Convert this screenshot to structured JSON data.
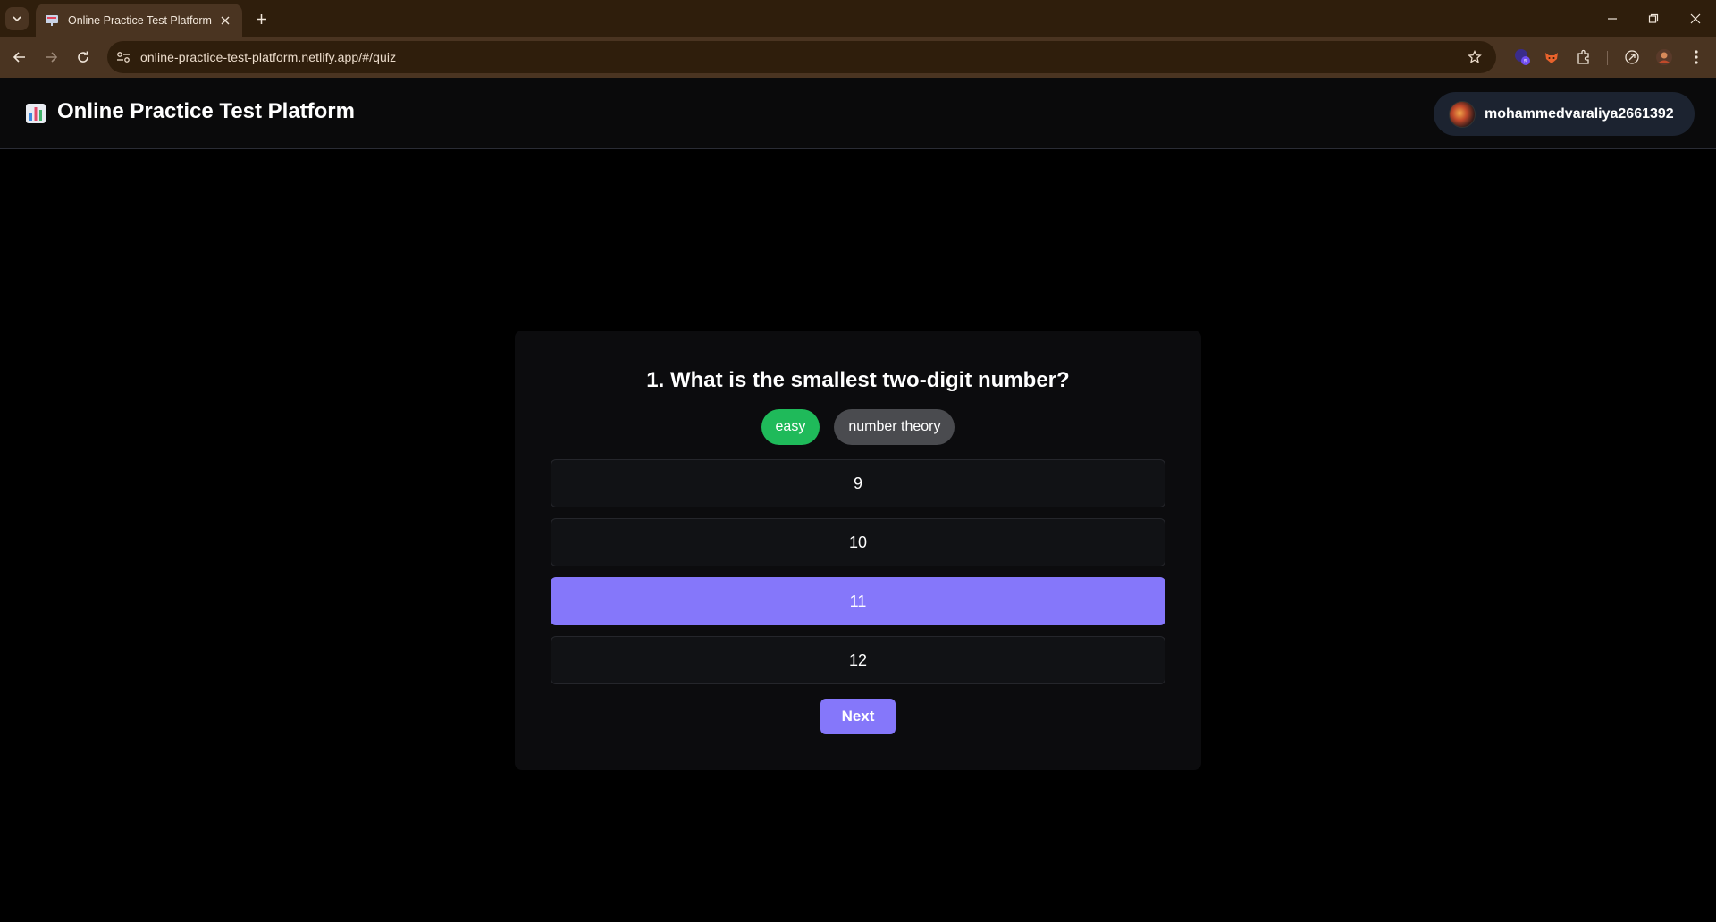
{
  "browser": {
    "tab_title": "Online Practice Test Platform",
    "url": "online-practice-test-platform.netlify.app/#/quiz",
    "extension_badge": "5"
  },
  "app": {
    "title": "Online Practice Test Platform",
    "username": "mohammedvaraliya2661392"
  },
  "quiz": {
    "question": "1. What is the smallest two-digit number?",
    "tags": [
      "easy",
      "number theory"
    ],
    "options": [
      "9",
      "10",
      "11",
      "12"
    ],
    "selected_option": "11",
    "next_label": "Next"
  },
  "colors": {
    "accent": "#8577fa",
    "easy_tag": "#1fba5a",
    "topic_tag": "#4a4b4f",
    "background": "#000000",
    "card": "#0c0c0e"
  },
  "icons": {
    "brand": "bar-chart-icon",
    "avatar": "user-avatar"
  }
}
